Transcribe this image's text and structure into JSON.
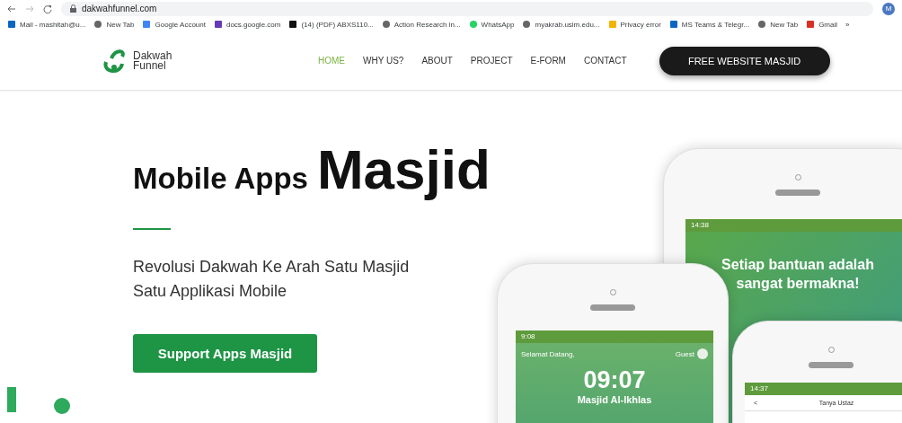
{
  "browser": {
    "url": "dakwahfunnel.com",
    "profile": "M",
    "bookmarks": [
      "Mail - mashitah@u...",
      "New Tab",
      "Google Account",
      "docs.google.com",
      "(14) (PDF) ABXS110...",
      "Action Research in...",
      "WhatsApp",
      "myakrab.usim.edu...",
      "Privacy error",
      "MS Teams & Telegr...",
      "New Tab",
      "Gmail"
    ],
    "more": "»"
  },
  "site": {
    "logo": {
      "line1": "Dakwah",
      "line2": "Funnel"
    },
    "nav": [
      {
        "label": "HOME",
        "selected": true
      },
      {
        "label": "WHY US?",
        "selected": false
      },
      {
        "label": "ABOUT",
        "selected": false
      },
      {
        "label": "PROJECT",
        "selected": false
      },
      {
        "label": "E-FORM",
        "selected": false
      },
      {
        "label": "CONTACT",
        "selected": false
      }
    ],
    "cta": "FREE WEBSITE MASJID",
    "hero": {
      "title_small": "Mobile Apps",
      "title_big": "Masjid",
      "subtitle_lines": [
        "Revolusi Dakwah Ke Arah Satu Masjid",
        "Satu Applikasi Mobile"
      ],
      "button": "Support Apps Masjid"
    },
    "phones": [
      {
        "kind": "banner",
        "time": "14:38",
        "headline_lines": [
          "Setiap bantuan adalah",
          "sangat bermakna!"
        ]
      },
      {
        "kind": "home",
        "time": "9:08",
        "greeting": "Selamat Datang,",
        "user": "Guest",
        "clock": "09:07",
        "mosque": "Masjid Al-Ikhlas"
      },
      {
        "kind": "page",
        "time": "14:37",
        "back": "<",
        "page_title": "Tanya Ustaz"
      }
    ]
  }
}
